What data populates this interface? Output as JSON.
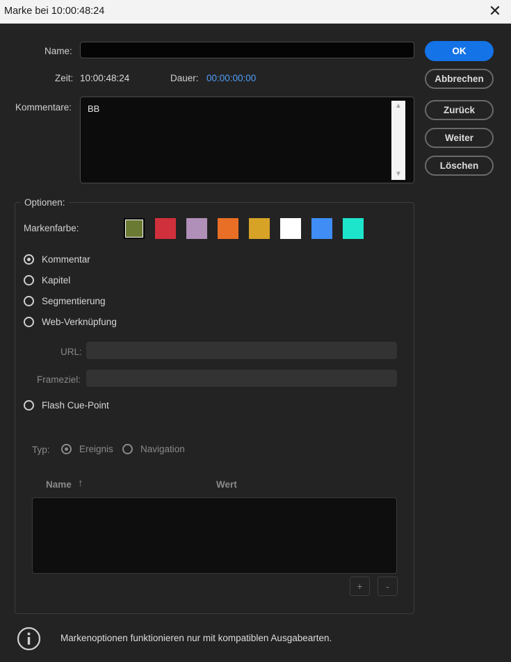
{
  "window": {
    "title": "Marke bei 10:00:48:24",
    "close_glyph": "✕"
  },
  "form": {
    "name_label": "Name:",
    "name_value": "",
    "zeit_label": "Zeit:",
    "zeit_value": "10:00:48:24",
    "dauer_label": "Dauer:",
    "dauer_value": "00:00:00:00",
    "kommentare_label": "Kommentare:",
    "kommentare_value": "BB"
  },
  "buttons": {
    "ok": "OK",
    "abbrechen": "Abbrechen",
    "zurueck": "Zurück",
    "weiter": "Weiter",
    "loeschen": "Löschen"
  },
  "options": {
    "legend": "Optionen:",
    "markenfarbe_label": "Markenfarbe:",
    "colors": [
      "#6b7a33",
      "#d0303c",
      "#b08fb8",
      "#ea6f26",
      "#d6a327",
      "#ffffff",
      "#3f8df5",
      "#1de5cc"
    ],
    "selected_color_index": 0,
    "types": {
      "kommentar": "Kommentar",
      "kapitel": "Kapitel",
      "segmentierung": "Segmentierung",
      "web": "Web-Verknüpfung",
      "flash": "Flash Cue-Point"
    },
    "selected_type": "kommentar",
    "url_label": "URL:",
    "url_value": "",
    "frameziel_label": "Frameziel:",
    "frameziel_value": "",
    "typ_label": "Typ:",
    "ereignis": "Ereignis",
    "navigation": "Navigation",
    "selected_cue_type": "ereignis",
    "col_name": "Name",
    "col_wert": "Wert",
    "add": "+",
    "remove": "-"
  },
  "footer": {
    "info_text": "Markenoptionen funktionieren nur mit kompatiblen Ausgabearten."
  },
  "colors": {
    "accent": "#1473e6",
    "time_blue": "#4f9ef8"
  }
}
